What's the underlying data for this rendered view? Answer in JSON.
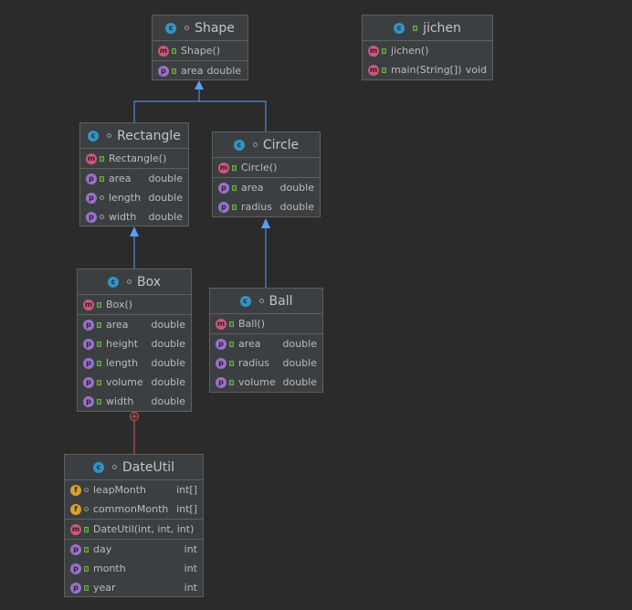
{
  "classes": {
    "shape": {
      "name": "Shape",
      "members": [
        {
          "icon": "m",
          "name": "Shape()",
          "type": ""
        }
      ],
      "fields": [
        {
          "icon": "p",
          "name": "area",
          "type": "double"
        }
      ]
    },
    "jichen": {
      "name": "jichen",
      "members": [
        {
          "icon": "m",
          "name": "jichen()",
          "type": ""
        },
        {
          "icon": "m",
          "name": "main(String[])",
          "type": "void"
        }
      ]
    },
    "rectangle": {
      "name": "Rectangle",
      "members": [
        {
          "icon": "m",
          "name": "Rectangle()",
          "type": ""
        }
      ],
      "fields": [
        {
          "icon": "p",
          "name": "area",
          "type": "double"
        },
        {
          "icon": "p",
          "name": "length",
          "type": "double"
        },
        {
          "icon": "p",
          "name": "width",
          "type": "double"
        }
      ]
    },
    "circle": {
      "name": "Circle",
      "members": [
        {
          "icon": "m",
          "name": "Circle()",
          "type": ""
        }
      ],
      "fields": [
        {
          "icon": "p",
          "name": "area",
          "type": "double"
        },
        {
          "icon": "p",
          "name": "radius",
          "type": "double"
        }
      ]
    },
    "box": {
      "name": "Box",
      "members": [
        {
          "icon": "m",
          "name": "Box()",
          "type": ""
        }
      ],
      "fields": [
        {
          "icon": "p",
          "name": "area",
          "type": "double"
        },
        {
          "icon": "p",
          "name": "height",
          "type": "double"
        },
        {
          "icon": "p",
          "name": "length",
          "type": "double"
        },
        {
          "icon": "p",
          "name": "volume",
          "type": "double"
        },
        {
          "icon": "p",
          "name": "width",
          "type": "double"
        }
      ]
    },
    "ball": {
      "name": "Ball",
      "members": [
        {
          "icon": "m",
          "name": "Ball()",
          "type": ""
        }
      ],
      "fields": [
        {
          "icon": "p",
          "name": "area",
          "type": "double"
        },
        {
          "icon": "p",
          "name": "radius",
          "type": "double"
        },
        {
          "icon": "p",
          "name": "volume",
          "type": "double"
        }
      ]
    },
    "dateutil": {
      "name": "DateUtil",
      "static_fields": [
        {
          "icon": "f",
          "name": "leapMonth",
          "type": "int[]"
        },
        {
          "icon": "f",
          "name": "commonMonth",
          "type": "int[]"
        }
      ],
      "members": [
        {
          "icon": "m",
          "name": "DateUtil(int, int, int)",
          "type": ""
        }
      ],
      "fields": [
        {
          "icon": "p",
          "name": "day",
          "type": "int"
        },
        {
          "icon": "p",
          "name": "month",
          "type": "int"
        },
        {
          "icon": "p",
          "name": "year",
          "type": "int"
        }
      ]
    }
  },
  "icons": {
    "class": "c",
    "method": "m",
    "property": "p",
    "field": "f"
  },
  "colors": {
    "background": "#2b2b2b",
    "node": "#3c3f41",
    "inheritance_edge": "#589df6",
    "inner_class_edge": "#d55b5b"
  }
}
